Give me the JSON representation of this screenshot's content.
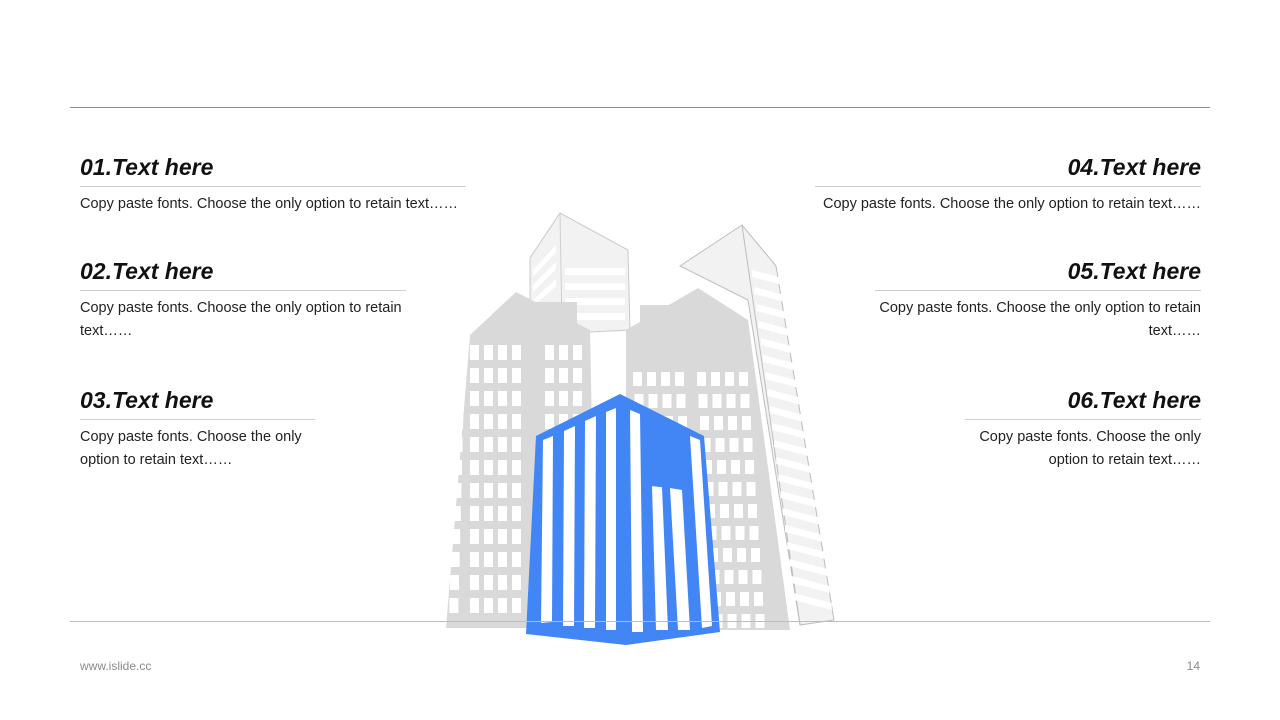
{
  "items": [
    {
      "title": "01.Text here",
      "body": "Copy paste fonts. Choose the only option to retain text……"
    },
    {
      "title": "02.Text here",
      "body": "Copy paste fonts. Choose the only option to retain text……"
    },
    {
      "title": "03.Text here",
      "body": "Copy paste fonts. Choose the only option to retain text……"
    },
    {
      "title": "04.Text here",
      "body": "Copy paste fonts. Choose the only option to retain text……"
    },
    {
      "title": "05.Text here",
      "body": "Copy paste fonts. Choose the only option to retain text……"
    },
    {
      "title": "06.Text here",
      "body": "Copy paste fonts. Choose the only option to retain text……"
    }
  ],
  "footer": {
    "url": "www.islide.cc",
    "page": "14"
  },
  "colors": {
    "accent": "#4285f4",
    "building_gray": "#d9d9d9",
    "building_light": "#eeeeee"
  },
  "illustration": {
    "icon": "buildings-illustration"
  }
}
